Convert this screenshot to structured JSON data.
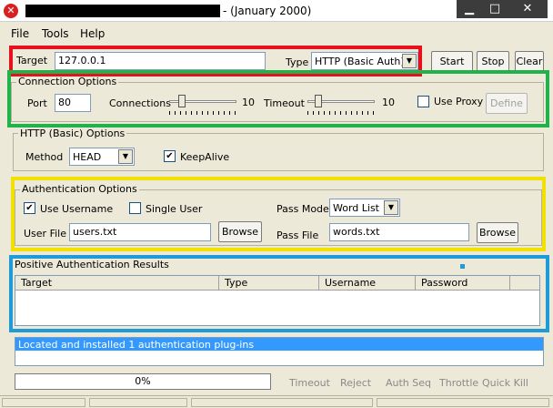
{
  "window": {
    "title": "- (January 2000)",
    "icon": "x-icon",
    "controls": {
      "minimize": "▁",
      "maximize": "□",
      "close": "✕"
    }
  },
  "menu": [
    "File",
    "Tools",
    "Help"
  ],
  "target_row": {
    "target_label": "Target",
    "target_value": "127.0.0.1",
    "type_label": "Type",
    "type_value": "HTTP (Basic Auth)",
    "start": "Start",
    "stop": "Stop",
    "clear": "Clear"
  },
  "connection": {
    "title": "Connection Options",
    "port_label": "Port",
    "port_value": "80",
    "connections_label": "Connections",
    "connections_value": "10",
    "timeout_label": "Timeout",
    "timeout_value": "10",
    "use_proxy_label": "Use Proxy",
    "use_proxy_checked": false,
    "define": "Define"
  },
  "http_options": {
    "title": "HTTP (Basic) Options",
    "method_label": "Method",
    "method_value": "HEAD",
    "keepalive_label": "KeepAlive",
    "keepalive_checked": true
  },
  "auth": {
    "title": "Authentication Options",
    "use_username_label": "Use Username",
    "use_username_checked": true,
    "single_user_label": "Single User",
    "single_user_checked": false,
    "pass_mode_label": "Pass Mode",
    "pass_mode_value": "Word List",
    "user_file_label": "User File",
    "user_file_value": "users.txt",
    "browse": "Browse",
    "pass_file_label": "Pass File",
    "pass_file_value": "words.txt"
  },
  "results": {
    "title": "Positive Authentication Results",
    "columns": [
      "Target",
      "Type",
      "Username",
      "Password"
    ]
  },
  "log": {
    "line": "Located and installed 1 authentication plug-ins"
  },
  "status": {
    "progress_text": "0%",
    "progress_fraction": 0,
    "timeout": "Timeout",
    "reject": "Reject",
    "auth_seq": "Auth Seq",
    "throttle": "Throttle",
    "quick_kill": "Quick Kill"
  },
  "colors": {
    "highlight_red": "#e8101c",
    "highlight_green": "#22b24c",
    "highlight_yellow": "#f2e100",
    "highlight_blue": "#1f9bd8",
    "log_selection": "#3399ff"
  }
}
